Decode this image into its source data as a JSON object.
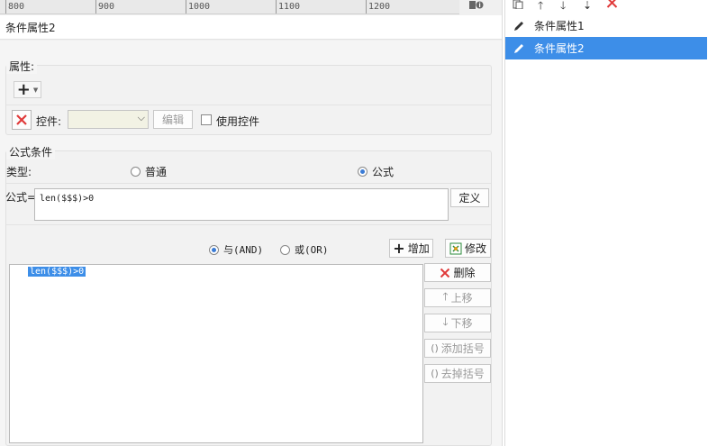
{
  "ruler": {
    "marks": [
      "800",
      "900",
      "1000",
      "1100",
      "1200"
    ]
  },
  "panel": {
    "title": "条件属性2"
  },
  "attributes": {
    "legend": "属性:",
    "add_symbol": "+",
    "control_label": "控件:",
    "control_value": "",
    "edit_button": "编辑",
    "use_control_label": "使用控件"
  },
  "formula_condition": {
    "legend": "公式条件",
    "type_label": "类型:",
    "type_normal": "普通",
    "type_formula": "公式",
    "formula_label": "公式=",
    "formula_value": "len($$$)>0",
    "define_button": "定义",
    "and_label": "与(AND)",
    "or_label": "或(OR)",
    "add_button": "增加",
    "modify_button": "修改",
    "conditions": [
      "len($$$)>0"
    ],
    "delete_button": "删除",
    "move_up_button": "上移",
    "move_down_button": "下移",
    "add_bracket_button": "添加括号",
    "remove_bracket_button": "去掉括号"
  },
  "condition_list": {
    "items": [
      {
        "label": "条件属性1",
        "selected": false
      },
      {
        "label": "条件属性2",
        "selected": true
      }
    ]
  },
  "colors": {
    "selection": "#3d8ee8",
    "delete_red": "#e03a3a"
  }
}
